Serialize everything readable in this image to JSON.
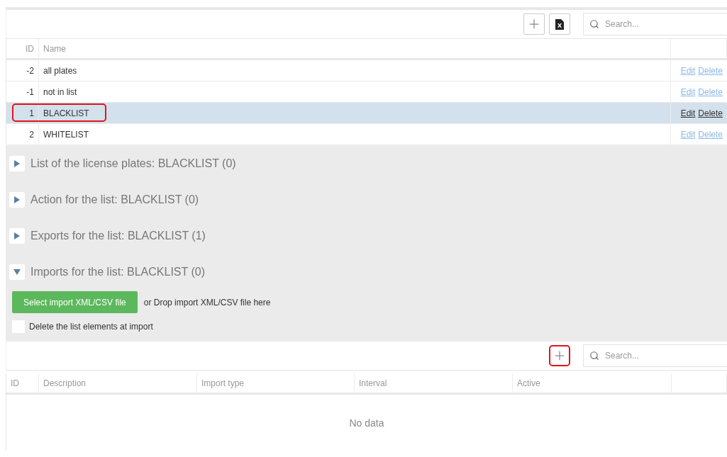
{
  "toolbar": {
    "search": {
      "placeholder": "Search..."
    }
  },
  "lists_table": {
    "columns": [
      "ID",
      "Name"
    ],
    "rows": [
      {
        "id": "-2",
        "name": "all plates",
        "selected": false,
        "annotated": false,
        "actions": [
          "Edit",
          "Delete"
        ]
      },
      {
        "id": "-1",
        "name": "not in list",
        "selected": false,
        "annotated": false,
        "actions": [
          "Edit",
          "Delete"
        ]
      },
      {
        "id": "1",
        "name": "BLACKLIST",
        "selected": true,
        "annotated": true,
        "actions": [
          "Edit",
          "Delete"
        ]
      },
      {
        "id": "2",
        "name": "WHITELIST",
        "selected": false,
        "annotated": false,
        "actions": [
          "Edit",
          "Delete"
        ]
      }
    ]
  },
  "sections": [
    {
      "title": "List of the license plates: BLACKLIST (0)",
      "expanded": false
    },
    {
      "title": "Action for the list: BLACKLIST (0)",
      "expanded": false
    },
    {
      "title": "Exports for the list: BLACKLIST (1)",
      "expanded": false
    },
    {
      "title": "Imports for the list: BLACKLIST (0)",
      "expanded": true
    }
  ],
  "import": {
    "button": "Select import XML/CSV file",
    "drop_hint": "or Drop import XML/CSV file here",
    "checkbox": {
      "label": "Delete the list elements at import",
      "checked": false
    }
  },
  "imports_toolbar": {
    "add_annotated": true,
    "search": {
      "placeholder": "Search..."
    }
  },
  "imports_table": {
    "columns": [
      "ID",
      "Description",
      "Import type",
      "Interval",
      "Active"
    ],
    "empty_text": "No data"
  }
}
